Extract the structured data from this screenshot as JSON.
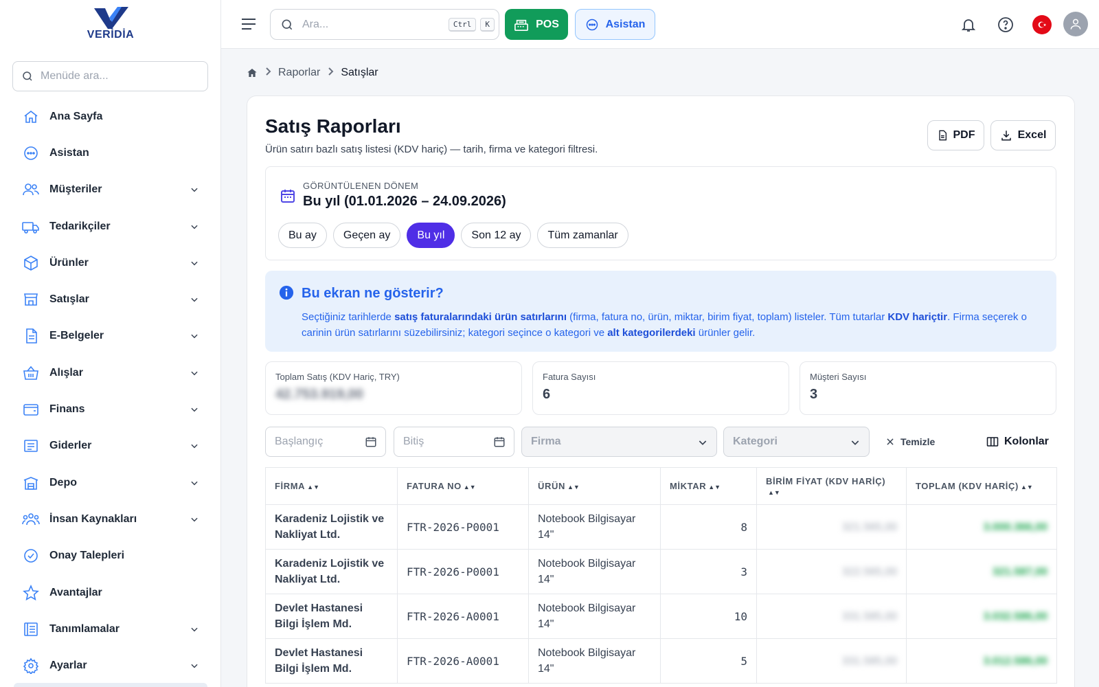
{
  "brand": {
    "name": "VERİDİA"
  },
  "sidebar": {
    "search_placeholder": "Menüde ara...",
    "items": [
      {
        "label": "Ana Sayfa",
        "icon": "home-icon",
        "expandable": false
      },
      {
        "label": "Asistan",
        "icon": "chat-icon",
        "expandable": false
      },
      {
        "label": "Müşteriler",
        "icon": "users-icon",
        "expandable": true
      },
      {
        "label": "Tedarikçiler",
        "icon": "truck-icon",
        "expandable": true
      },
      {
        "label": "Ürünler",
        "icon": "box-icon",
        "expandable": true
      },
      {
        "label": "Satışlar",
        "icon": "store-icon",
        "expandable": true
      },
      {
        "label": "E-Belgeler",
        "icon": "document-icon",
        "expandable": true
      },
      {
        "label": "Alışlar",
        "icon": "basket-icon",
        "expandable": true
      },
      {
        "label": "Finans",
        "icon": "wallet-icon",
        "expandable": true
      },
      {
        "label": "Giderler",
        "icon": "receipt-icon",
        "expandable": true
      },
      {
        "label": "Depo",
        "icon": "warehouse-icon",
        "expandable": true
      },
      {
        "label": "İnsan Kaynakları",
        "icon": "team-icon",
        "expandable": true
      },
      {
        "label": "Onay Talepleri",
        "icon": "check-circle-icon",
        "expandable": false
      },
      {
        "label": "Avantajlar",
        "icon": "star-icon",
        "expandable": false
      },
      {
        "label": "Tanımlamalar",
        "icon": "list-icon",
        "expandable": true
      },
      {
        "label": "Ayarlar",
        "icon": "gear-icon",
        "expandable": true
      }
    ]
  },
  "topbar": {
    "search_placeholder": "Ara...",
    "shortcut_keys": [
      "Ctrl",
      "K"
    ],
    "pos_label": "POS",
    "assistant_label": "Asistan",
    "pos_color": "#119c5a"
  },
  "breadcrumb": {
    "items": [
      "Raporlar",
      "Satışlar"
    ]
  },
  "page": {
    "title": "Satış Raporları",
    "subtitle": "Ürün satırı bazlı satış listesi (KDV hariç) — tarih, firma ve kategori filtresi.",
    "pdf_label": "PDF",
    "excel_label": "Excel"
  },
  "period": {
    "kicker": "GÖRÜNTÜLENEN DÖNEM",
    "value": "Bu yıl (01.01.2026 – 24.09.2026)",
    "chips": [
      "Bu ay",
      "Geçen ay",
      "Bu yıl",
      "Son 12 ay",
      "Tüm zamanlar"
    ],
    "active_chip": "Bu yıl",
    "accent": "#4f2ee6"
  },
  "info": {
    "title": "Bu ekran ne gösterir?",
    "p1": "Seçtiğiniz tarihlerde ",
    "b1": "satış faturalarındaki ürün satırlarını",
    "p2": " (firma, fatura no, ürün, miktar, birim fiyat, toplam) listeler. Tüm tutarlar ",
    "b2": "KDV hariçtir",
    "p3": ". Firma seçerek o carinin ürün satırlarını süzebilirsiniz; kategori seçince o kategori ve ",
    "b3": "alt kategorilerdeki",
    "p4": " ürünler gelir."
  },
  "stats": [
    {
      "label": "Toplam Satış (KDV Hariç, TRY)",
      "value": "42.753.919,00",
      "blurred": true
    },
    {
      "label": "Fatura Sayısı",
      "value": "6",
      "blurred": false
    },
    {
      "label": "Müşteri Sayısı",
      "value": "3",
      "blurred": false
    }
  ],
  "filters": {
    "start_placeholder": "Başlangıç",
    "end_placeholder": "Bitiş",
    "firm_placeholder": "Firma",
    "category_placeholder": "Kategori",
    "clear_label": "Temizle",
    "columns_label": "Kolonlar"
  },
  "table": {
    "headers": [
      "FİRMA",
      "FATURA NO",
      "ÜRÜN",
      "MİKTAR",
      "BİRİM FİYAT (KDV HARİÇ)",
      "TOPLAM (KDV HARİÇ)"
    ],
    "rows": [
      {
        "firma": "Karadeniz Lojistik ve Nakliyat Ltd.",
        "fatura": "FTR-2026-P0001",
        "urun": "Notebook Bilgisayar 14\"",
        "miktar": "8",
        "birim": "321.565,00",
        "toplam": "3.000.366,00"
      },
      {
        "firma": "Karadeniz Lojistik ve Nakliyat Ltd.",
        "fatura": "FTR-2026-P0001",
        "urun": "Notebook Bilgisayar 14\"",
        "miktar": "3",
        "birim": "322.565,00",
        "toplam": "321.587,00"
      },
      {
        "firma": "Devlet Hastanesi Bilgi İşlem Md.",
        "fatura": "FTR-2026-A0001",
        "urun": "Notebook Bilgisayar 14\"",
        "miktar": "10",
        "birim": "331.585,00",
        "toplam": "3.032.586,00"
      },
      {
        "firma": "Devlet Hastanesi Bilgi İşlem Md.",
        "fatura": "FTR-2026-A0001",
        "urun": "Notebook Bilgisayar 14\"",
        "miktar": "5",
        "birim": "331.585,00",
        "toplam": "3.012.586,00"
      }
    ]
  }
}
